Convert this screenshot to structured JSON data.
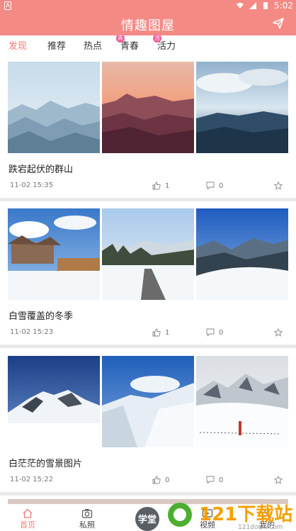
{
  "status_bar": {
    "time": "5:02",
    "app_icon": "a-icon"
  },
  "header": {
    "title": "情趣图屋",
    "send_icon": "send-icon"
  },
  "tabs": [
    {
      "label": "发现",
      "active": true,
      "badge": ""
    },
    {
      "label": "推荐",
      "active": false,
      "badge": ""
    },
    {
      "label": "热点",
      "active": false,
      "badge": ""
    },
    {
      "label": "青春",
      "active": false,
      "badge": "青"
    },
    {
      "label": "活力",
      "active": false,
      "badge": "活"
    }
  ],
  "posts": [
    {
      "title": "跌宕起伏的群山",
      "time": "11-02 15:35",
      "likes": "1",
      "comments": "0"
    },
    {
      "title": "白雪覆盖的冬季",
      "time": "11-02 15:23",
      "likes": "1",
      "comments": "0"
    },
    {
      "title": "白茫茫的雪景图片",
      "time": "11-02 15:22",
      "likes": "0",
      "comments": "0"
    }
  ],
  "bottom_nav": [
    {
      "label": "首页",
      "icon": "home-icon",
      "active": true
    },
    {
      "label": "私照",
      "icon": "camera-icon",
      "active": false
    },
    {
      "label": "视频",
      "icon": "video-icon",
      "active": false
    },
    {
      "label": "我的",
      "icon": "profile-icon",
      "active": false
    }
  ],
  "watermark": {
    "brand": "121下载站",
    "url": "121down.com",
    "badge": "学堂"
  },
  "colors": {
    "accent": "#f48a84",
    "active_text": "#f27c77",
    "separator": "#e9e9e9"
  }
}
